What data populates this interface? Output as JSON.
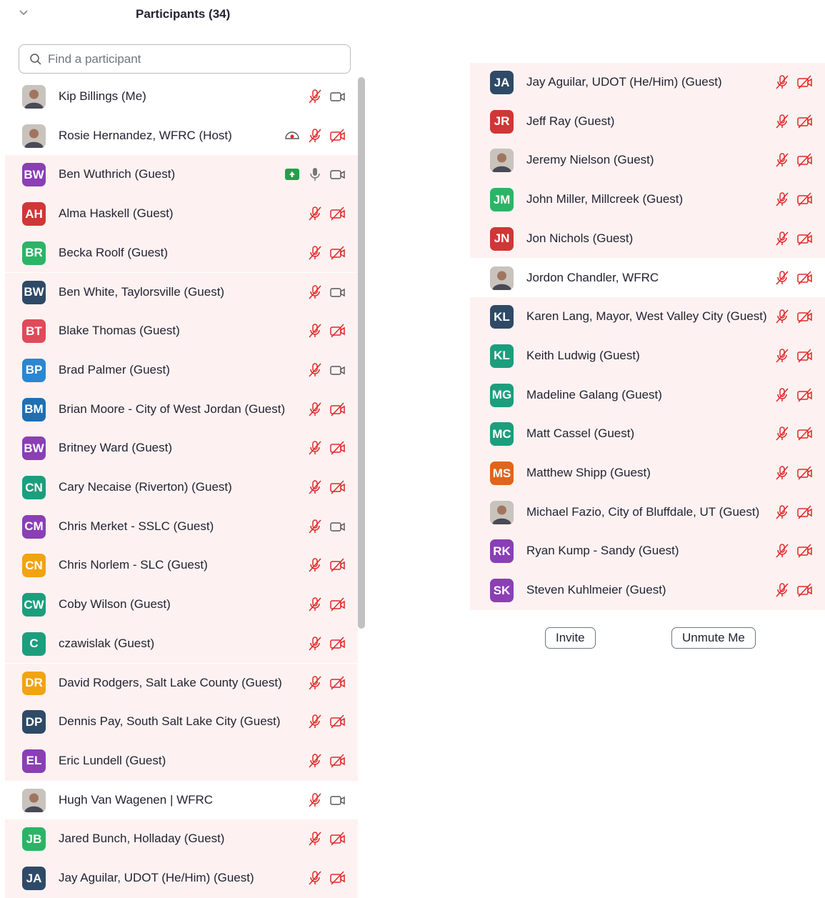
{
  "header": {
    "title": "Participants (34)",
    "collapse_icon": "chevron-down-icon"
  },
  "search": {
    "placeholder": "Find a participant",
    "value": ""
  },
  "colors": {
    "muted_red": "#e02828",
    "highlight_bg": "#fdf2f1",
    "host_gray": "#6e7680"
  },
  "left_list": [
    {
      "initials": "",
      "photo": true,
      "name": "Kip Billings (Me)",
      "highlight": false,
      "mic": "muted",
      "video": "on"
    },
    {
      "initials": "",
      "photo": true,
      "name": "Rosie Hernandez, WFRC (Host)",
      "highlight": false,
      "recording": true,
      "mic": "muted",
      "video": "off"
    },
    {
      "initials": "BW",
      "color": "#8a3fb5",
      "name": "Ben Wuthrich (Guest)",
      "highlight": true,
      "sharing": true,
      "mic": "on",
      "video": "on"
    },
    {
      "initials": "AH",
      "color": "#cf3737",
      "name": "Alma Haskell (Guest)",
      "highlight": true,
      "mic": "muted",
      "video": "off"
    },
    {
      "initials": "BR",
      "color": "#2cb466",
      "name": "Becka Roolf (Guest)",
      "highlight": true,
      "mic": "muted",
      "video": "off"
    },
    {
      "initials": "BW",
      "color": "#2f4a66",
      "name": "Ben White, Taylorsville (Guest)",
      "highlight": true,
      "mic": "muted",
      "video": "on"
    },
    {
      "initials": "BT",
      "color": "#e04a5a",
      "name": "Blake Thomas (Guest)",
      "highlight": true,
      "mic": "muted",
      "video": "off"
    },
    {
      "initials": "BP",
      "color": "#2b87d1",
      "name": "Brad Palmer (Guest)",
      "highlight": true,
      "mic": "muted",
      "video": "on"
    },
    {
      "initials": "BM",
      "color": "#1f6fb2",
      "name": "Brian Moore - City of West Jordan (Guest)",
      "highlight": true,
      "mic": "muted",
      "video": "off"
    },
    {
      "initials": "BW",
      "color": "#8a3fb5",
      "name": "Britney Ward (Guest)",
      "highlight": true,
      "mic": "muted",
      "video": "off"
    },
    {
      "initials": "CN",
      "color": "#1c9e7d",
      "name": "Cary Necaise (Riverton) (Guest)",
      "highlight": true,
      "mic": "muted",
      "video": "off"
    },
    {
      "initials": "CM",
      "color": "#8a3fb5",
      "name": "Chris Merket - SSLC (Guest)",
      "highlight": true,
      "mic": "muted",
      "video": "on"
    },
    {
      "initials": "CN",
      "color": "#f2a312",
      "name": "Chris Norlem - SLC (Guest)",
      "highlight": true,
      "mic": "muted",
      "video": "off"
    },
    {
      "initials": "CW",
      "color": "#1c9e7d",
      "name": "Coby Wilson (Guest)",
      "highlight": true,
      "mic": "muted",
      "video": "off"
    },
    {
      "initials": "C",
      "color": "#1c9e7d",
      "name": "czawislak (Guest)",
      "highlight": true,
      "mic": "muted",
      "video": "off"
    },
    {
      "initials": "DR",
      "color": "#f2a312",
      "name": "David Rodgers, Salt Lake County (Guest)",
      "highlight": true,
      "mic": "muted",
      "video": "off"
    },
    {
      "initials": "DP",
      "color": "#2f4a66",
      "name": "Dennis Pay, South Salt Lake City (Guest)",
      "highlight": true,
      "mic": "muted",
      "video": "off"
    },
    {
      "initials": "EL",
      "color": "#8a3fb5",
      "name": "Eric Lundell (Guest)",
      "highlight": true,
      "mic": "muted",
      "video": "off"
    },
    {
      "initials": "",
      "photo": true,
      "name": "Hugh Van Wagenen | WFRC",
      "highlight": false,
      "mic": "muted",
      "video": "on"
    },
    {
      "initials": "JB",
      "color": "#2cb466",
      "name": "Jared Bunch, Holladay (Guest)",
      "highlight": true,
      "mic": "muted",
      "video": "off"
    },
    {
      "initials": "JA",
      "color": "#2f4a66",
      "name": "Jay Aguilar, UDOT (He/Him) (Guest)",
      "highlight": true,
      "mic": "muted",
      "video": "off"
    }
  ],
  "right_list": [
    {
      "initials": "JA",
      "color": "#2f4a66",
      "name": "Jay Aguilar, UDOT (He/Him) (Guest)",
      "highlight": true,
      "mic": "muted",
      "video": "off"
    },
    {
      "initials": "JR",
      "color": "#cf3737",
      "name": "Jeff Ray (Guest)",
      "highlight": true,
      "mic": "muted",
      "video": "off"
    },
    {
      "initials": "",
      "photo": true,
      "name": "Jeremy Nielson (Guest)",
      "highlight": true,
      "mic": "muted",
      "video": "off"
    },
    {
      "initials": "JM",
      "color": "#2cb466",
      "name": "John Miller, Millcreek (Guest)",
      "highlight": true,
      "mic": "muted",
      "video": "off"
    },
    {
      "initials": "JN",
      "color": "#cf3737",
      "name": "Jon Nichols (Guest)",
      "highlight": true,
      "mic": "muted",
      "video": "off"
    },
    {
      "initials": "",
      "photo": true,
      "name": "Jordon Chandler, WFRC",
      "highlight": false,
      "mic": "muted",
      "video": "off"
    },
    {
      "initials": "KL",
      "color": "#2f4a66",
      "name": "Karen Lang, Mayor, West Valley City (Guest)",
      "highlight": true,
      "mic": "muted",
      "video": "off"
    },
    {
      "initials": "KL",
      "color": "#1c9e7d",
      "name": "Keith Ludwig (Guest)",
      "highlight": true,
      "mic": "muted",
      "video": "off"
    },
    {
      "initials": "MG",
      "color": "#1c9e7d",
      "name": "Madeline Galang (Guest)",
      "highlight": true,
      "mic": "muted",
      "video": "off"
    },
    {
      "initials": "MC",
      "color": "#1c9e7d",
      "name": "Matt Cassel (Guest)",
      "highlight": true,
      "mic": "muted",
      "video": "off"
    },
    {
      "initials": "MS",
      "color": "#e0651c",
      "name": "Matthew Shipp (Guest)",
      "highlight": true,
      "mic": "muted",
      "video": "off"
    },
    {
      "initials": "",
      "photo": true,
      "name": "Michael Fazio, City of Bluffdale, UT (Guest)",
      "highlight": true,
      "mic": "muted",
      "video": "off"
    },
    {
      "initials": "RK",
      "color": "#8a3fb5",
      "name": "Ryan Kump - Sandy (Guest)",
      "highlight": true,
      "mic": "muted",
      "video": "off"
    },
    {
      "initials": "SK",
      "color": "#8a3fb5",
      "name": "Steven Kuhlmeier (Guest)",
      "highlight": true,
      "mic": "muted",
      "video": "off"
    }
  ],
  "buttons": {
    "invite": "Invite",
    "unmute": "Unmute Me"
  }
}
